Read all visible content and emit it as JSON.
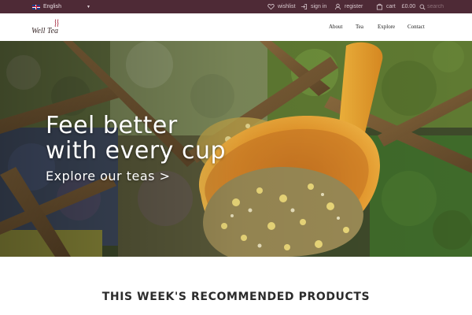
{
  "topbar": {
    "language": "English",
    "wishlist_label": "wishlist",
    "signin_label": "sign in",
    "register_label": "register",
    "cart_label": "cart",
    "cart_amount": "£0.00",
    "search_placeholder": "search"
  },
  "header": {
    "logo_text": "Well Tea",
    "nav": {
      "about": "About",
      "tea": "Tea",
      "explore": "Explore",
      "contact": "Contact"
    }
  },
  "hero": {
    "title": "Feel better\nwith every cup",
    "cta": "Explore our teas >"
  },
  "section": {
    "title": "THIS WEEK'S RECOMMENDED PRODUCTS"
  },
  "colors": {
    "topbar_bg": "#4e2a36",
    "accent": "#e8a23a"
  },
  "icons": [
    "flag-uk-icon",
    "chevron-down-icon",
    "heart-icon",
    "sign-in-icon",
    "user-icon",
    "bag-icon",
    "search-icon",
    "steam-cup-icon"
  ]
}
